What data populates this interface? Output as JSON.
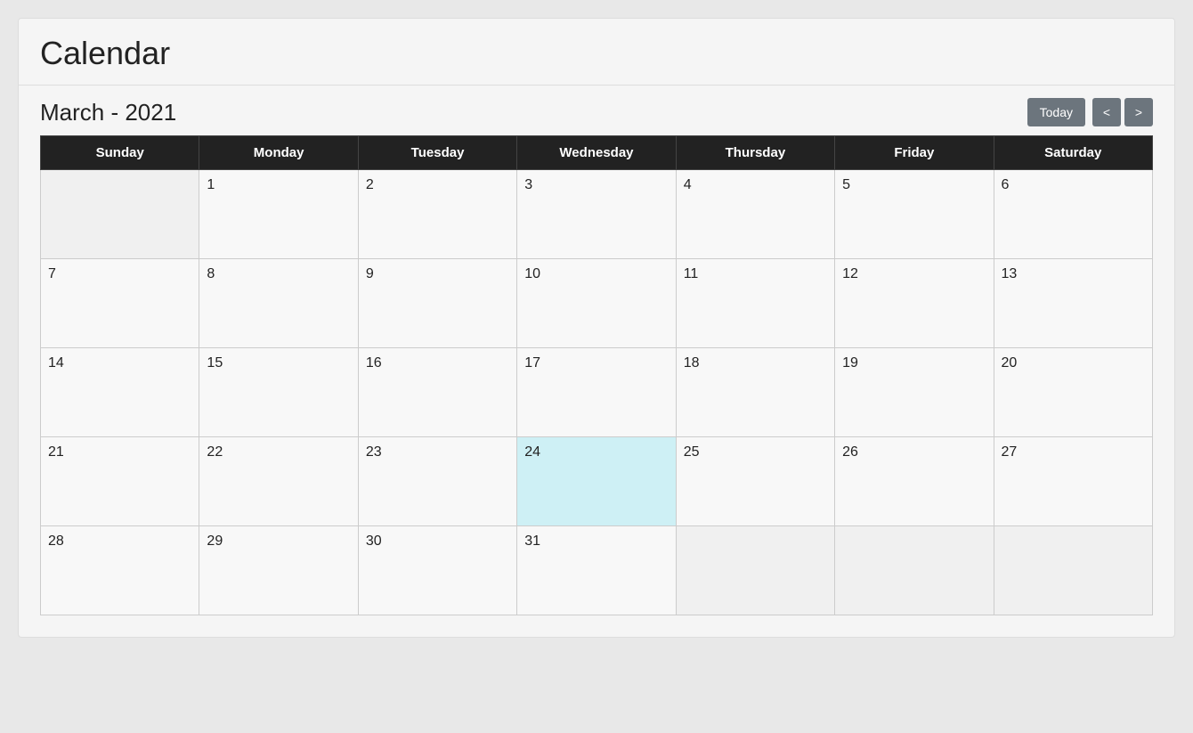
{
  "app": {
    "title": "Calendar"
  },
  "header": {
    "month_year": "March - 2021",
    "today_label": "Today",
    "prev_label": "<",
    "next_label": ">"
  },
  "days_of_week": [
    "Sunday",
    "Monday",
    "Tuesday",
    "Wednesday",
    "Thursday",
    "Friday",
    "Saturday"
  ],
  "weeks": [
    [
      {
        "day": "",
        "empty": true
      },
      {
        "day": "1"
      },
      {
        "day": "2"
      },
      {
        "day": "3"
      },
      {
        "day": "4"
      },
      {
        "day": "5"
      },
      {
        "day": "6"
      }
    ],
    [
      {
        "day": "7"
      },
      {
        "day": "8"
      },
      {
        "day": "9"
      },
      {
        "day": "10"
      },
      {
        "day": "11"
      },
      {
        "day": "12"
      },
      {
        "day": "13"
      }
    ],
    [
      {
        "day": "14"
      },
      {
        "day": "15"
      },
      {
        "day": "16"
      },
      {
        "day": "17"
      },
      {
        "day": "18"
      },
      {
        "day": "19"
      },
      {
        "day": "20"
      }
    ],
    [
      {
        "day": "21"
      },
      {
        "day": "22"
      },
      {
        "day": "23"
      },
      {
        "day": "24",
        "today": true
      },
      {
        "day": "25"
      },
      {
        "day": "26"
      },
      {
        "day": "27"
      }
    ],
    [
      {
        "day": "28"
      },
      {
        "day": "29"
      },
      {
        "day": "30"
      },
      {
        "day": "31"
      },
      {
        "day": "",
        "empty": true
      },
      {
        "day": "",
        "empty": true
      },
      {
        "day": "",
        "empty": true
      }
    ]
  ],
  "colors": {
    "header_bg": "#222222",
    "today_bg": "#cef0f5",
    "empty_bg": "#f0f0f0",
    "cell_bg": "#f8f8f8",
    "nav_btn_bg": "#6c757d"
  }
}
